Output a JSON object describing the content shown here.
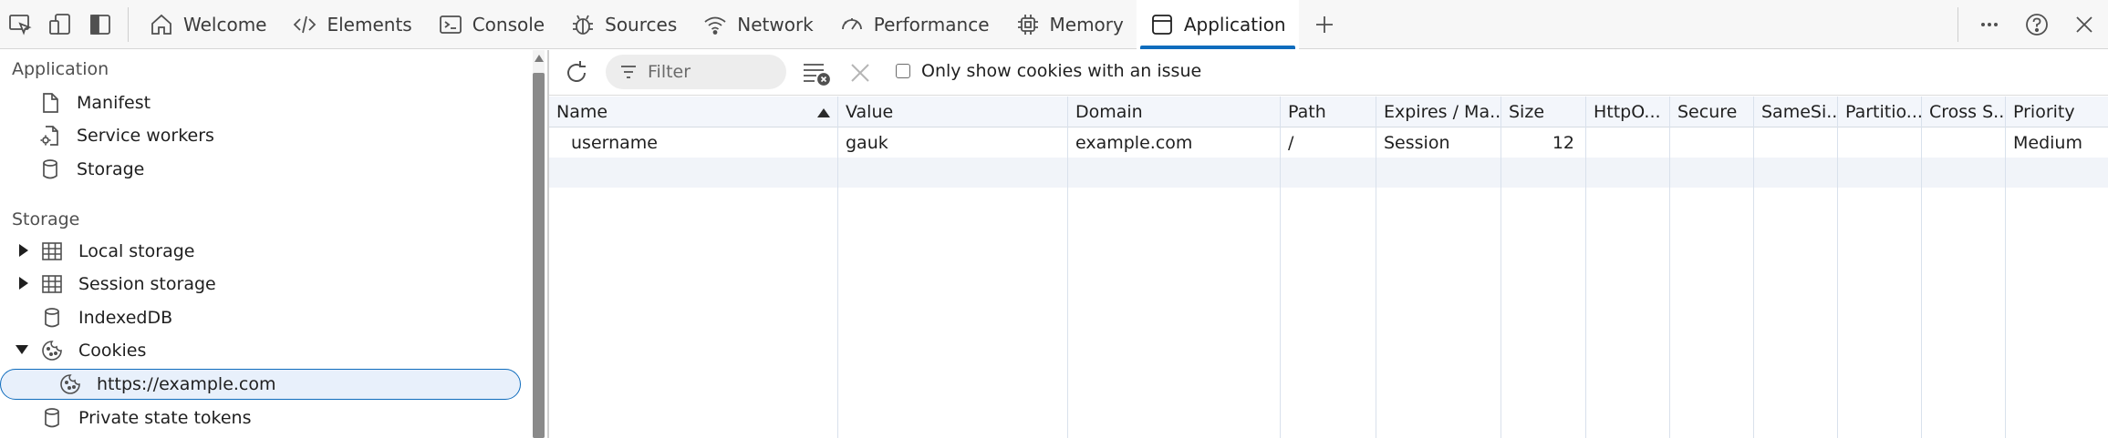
{
  "toolbar": {
    "tabs": [
      {
        "label": "Welcome",
        "icon": "home-icon"
      },
      {
        "label": "Elements",
        "icon": "code-icon"
      },
      {
        "label": "Console",
        "icon": "console-icon"
      },
      {
        "label": "Sources",
        "icon": "bug-icon"
      },
      {
        "label": "Network",
        "icon": "wifi-icon"
      },
      {
        "label": "Performance",
        "icon": "gauge-icon"
      },
      {
        "label": "Memory",
        "icon": "chip-icon"
      },
      {
        "label": "Application",
        "icon": "application-icon",
        "active": true
      }
    ],
    "accent": "#0f6cbd"
  },
  "sidebar": {
    "application_title": "Application",
    "application_items": [
      {
        "label": "Manifest",
        "icon": "document-icon"
      },
      {
        "label": "Service workers",
        "icon": "gear-document-icon"
      },
      {
        "label": "Storage",
        "icon": "database-icon"
      }
    ],
    "storage_title": "Storage",
    "storage_items": [
      {
        "label": "Local storage",
        "icon": "grid-icon",
        "expanded": false
      },
      {
        "label": "Session storage",
        "icon": "grid-icon",
        "expanded": false
      },
      {
        "label": "IndexedDB",
        "icon": "database-icon"
      },
      {
        "label": "Cookies",
        "icon": "cookie-icon",
        "expanded": true
      },
      {
        "label": "https://example.com",
        "icon": "cookie-icon",
        "selected": true
      },
      {
        "label": "Private state tokens",
        "icon": "database-icon"
      }
    ]
  },
  "cookies_toolbar": {
    "filter_placeholder": "Filter",
    "issue_checkbox_label": "Only show cookies with an issue",
    "issue_checked": false
  },
  "table": {
    "columns": [
      "Name",
      "Value",
      "Domain",
      "Path",
      "Expires / Ma...",
      "Size",
      "HttpO...",
      "Secure",
      "SameSi...",
      "Partitio...",
      "Cross S...",
      "Priority"
    ],
    "sorted_column": "Name",
    "rows": [
      {
        "name": "username",
        "value": "gauk",
        "domain": "example.com",
        "path": "/",
        "expires": "Session",
        "size": "12",
        "httponly": "",
        "secure": "",
        "samesite": "",
        "partition": "",
        "cross_site": "",
        "priority": "Medium"
      }
    ]
  }
}
